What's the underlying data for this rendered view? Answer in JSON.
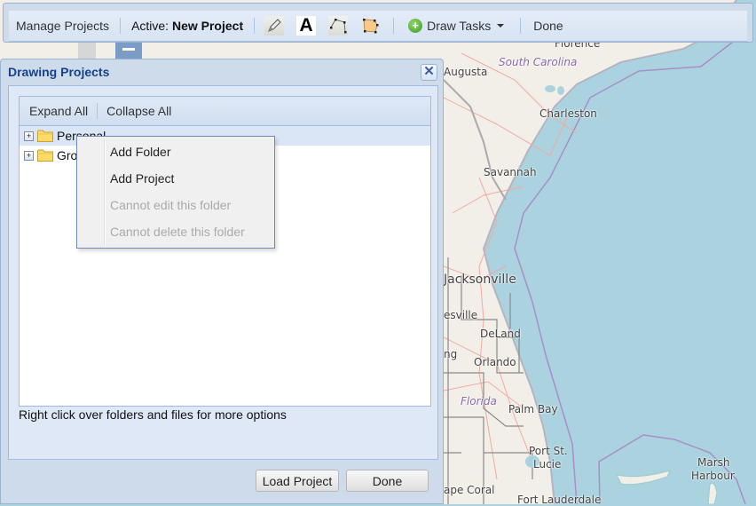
{
  "toolbar": {
    "manage_projects": "Manage Projects",
    "active_prefix": "Active:",
    "active_project": "New Project",
    "tools": [
      {
        "name": "pencil-icon",
        "label": "Freehand"
      },
      {
        "name": "text-icon",
        "label": "A"
      },
      {
        "name": "polyline-icon",
        "label": "Polyline"
      },
      {
        "name": "polygon-icon",
        "label": "Polygon"
      }
    ],
    "draw_tasks": "Draw Tasks",
    "done": "Done"
  },
  "dialog": {
    "title": "Drawing Projects",
    "close_symbol": "✕",
    "tree_toolbar": {
      "expand_all": "Expand All",
      "collapse_all": "Collapse All"
    },
    "tree": [
      {
        "label": "Personal",
        "expander": "+",
        "selected": true
      },
      {
        "label": "Gro",
        "expander": "+",
        "selected": false
      }
    ],
    "hint": "Right click over folders and files for more options",
    "load_project": "Load Project",
    "done": "Done"
  },
  "context_menu": {
    "items": [
      {
        "label": "Add Folder",
        "enabled": true
      },
      {
        "label": "Add Project",
        "enabled": true
      },
      {
        "label": "Cannot edit this folder",
        "enabled": false
      },
      {
        "label": "Cannot delete this folder",
        "enabled": false
      }
    ]
  },
  "map": {
    "labels": [
      {
        "text": "Florence",
        "kind": "city"
      },
      {
        "text": "South Carolina",
        "kind": "state"
      },
      {
        "text": "Augusta",
        "kind": "city"
      },
      {
        "text": "Charleston",
        "kind": "city"
      },
      {
        "text": "Savannah",
        "kind": "city"
      },
      {
        "text": "Jacksonville",
        "kind": "city"
      },
      {
        "text": "esville",
        "kind": "city"
      },
      {
        "text": "DeLand",
        "kind": "city"
      },
      {
        "text": "ng",
        "kind": "city"
      },
      {
        "text": "Orlando",
        "kind": "city"
      },
      {
        "text": "Florida",
        "kind": "state"
      },
      {
        "text": "Palm Bay",
        "kind": "city"
      },
      {
        "text": "Port St.",
        "kind": "city"
      },
      {
        "text": "Lucie",
        "kind": "city"
      },
      {
        "text": "Marsh",
        "kind": "city"
      },
      {
        "text": "Harbour",
        "kind": "city"
      },
      {
        "text": "ape Coral",
        "kind": "city"
      },
      {
        "text": "Fort Lauderdale",
        "kind": "city"
      }
    ]
  }
}
